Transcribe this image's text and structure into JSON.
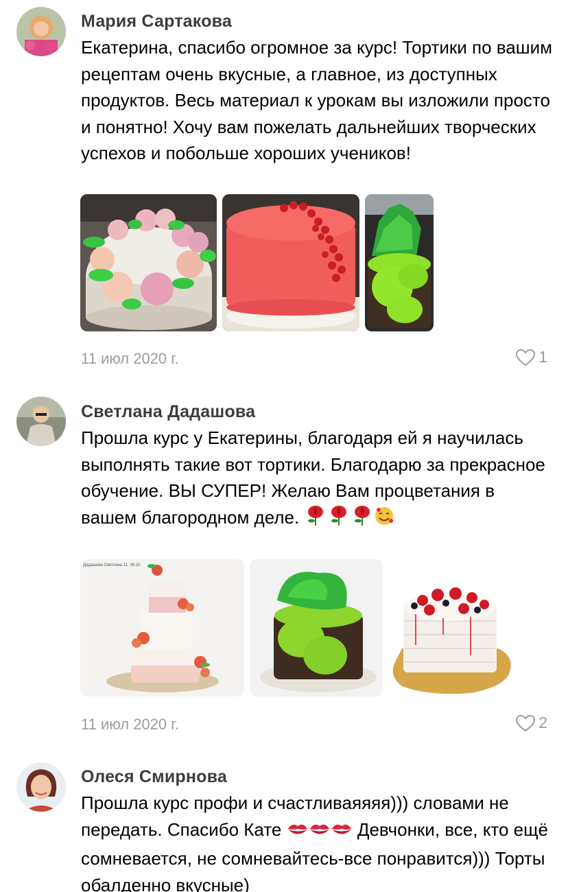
{
  "comments": [
    {
      "author": "Мария Сартакова",
      "text": "Екатерина, спасибо огромное за курс! Тортики по вашим рецептам очень вкусные, а главное, из доступных продуктов. Весь материал к урокам вы изложили просто и понятно! Хочу вам пожелать дальнейших творческих успехов и побольше хороших учеников!",
      "date": "11 июл 2020 г.",
      "likes": "1",
      "photos": [
        "cake-roses-photo",
        "red-glaze-cake-photo",
        "green-moss-cake-photo"
      ]
    },
    {
      "author": "Светлана Дадашова",
      "text": "Прошла курс у Екатерины, благодаря ей я научилась выполнять такие вот тортики. Благодарю за прекрасное обучение. ВЫ СУПЕР! Желаю Вам процветания в вашем благородном деле.",
      "date": "11 июл 2020 г.",
      "likes": "2",
      "photo_caption": "Дадашова Светлана 11. 06.20",
      "photos": [
        "tiered-cake-photo",
        "green-moss-cake-photo",
        "berry-cake-photo"
      ]
    },
    {
      "author": "Олеся Смирнова",
      "text_part1": "Прошла курс профи и счастливаяяяя))) словами не передать. Спасибо Кате",
      "text_part2": "Девчонки, все, кто ещё сомневается, не сомневайтесь-все понравится))) Торты обалденно вкусные)"
    }
  ],
  "icons": {
    "heart": "heart-outline-icon",
    "rose": "rose-emoji",
    "smile": "smiling-face-with-hearts-emoji",
    "kiss": "kiss-mark-emoji"
  },
  "colors": {
    "meta": "#9b9ca0",
    "author": "#3d3d3f"
  }
}
